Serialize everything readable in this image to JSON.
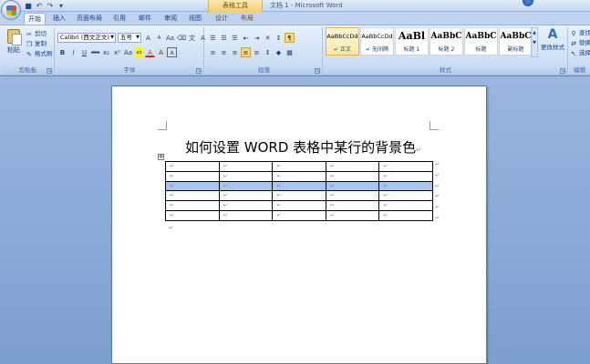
{
  "window": {
    "title": "文档 1 - Microsoft Word",
    "context_tools_label": "表格工具"
  },
  "quick_access": {
    "icons": [
      "save-icon",
      "undo-icon",
      "redo-icon",
      "customize-icon"
    ],
    "glyphs": [
      "■",
      "↶",
      "↷",
      "▾"
    ]
  },
  "tabs": [
    {
      "label": "开始",
      "active": true
    },
    {
      "label": "插入"
    },
    {
      "label": "页面布局"
    },
    {
      "label": "引用"
    },
    {
      "label": "邮件"
    },
    {
      "label": "审阅"
    },
    {
      "label": "视图"
    },
    {
      "label": "设计",
      "context": true
    },
    {
      "label": "布局",
      "context": true
    }
  ],
  "clipboard": {
    "paste": "粘贴",
    "cut": "剪切",
    "copy": "复制",
    "format_painter": "格式刷",
    "group_label": "剪贴板"
  },
  "font": {
    "font_name": "Calibri (西文正文)",
    "font_size": "五号",
    "group_label": "字体",
    "row1_buttons": [
      "A",
      "A",
      "Aa",
      "⌫",
      "文",
      "A"
    ],
    "row2_buttons": [
      "B",
      "I",
      "U",
      "abe",
      "x₂",
      "x²",
      "Aa",
      "ab",
      "A",
      "A",
      "A"
    ]
  },
  "paragraph": {
    "group_label": "段落",
    "row1_buttons": [
      "☰",
      "☰",
      "☰",
      "⇤",
      "⇥",
      "✕",
      "↕",
      "¶"
    ],
    "row2_buttons": [
      "≡",
      "≡",
      "≡",
      "≡",
      "≡",
      "↕",
      "◆",
      "▦"
    ]
  },
  "styles": {
    "group_label": "样式",
    "tiles": [
      {
        "sample": "AaBbCcDd",
        "name": "↵ 正文",
        "selected": true
      },
      {
        "sample": "AaBbCcDd",
        "name": "↵ 无间隔"
      },
      {
        "sample": "AaBl",
        "name": "标题 1"
      },
      {
        "sample": "AaBbC",
        "name": "标题 2"
      },
      {
        "sample": "AaBbC",
        "name": "标题"
      },
      {
        "sample": "AaBbC",
        "name": "副标题"
      }
    ],
    "change_styles": "更改样式"
  },
  "editing": {
    "group_label": "编辑",
    "find": "查找",
    "replace": "替换",
    "select": "选择"
  },
  "document": {
    "title": "如何设置 WORD 表格中某行的背景色",
    "paragraph_mark": "↵",
    "table_anchor": "✥",
    "table": {
      "rows": 6,
      "cols": 5,
      "shaded_row_index": 2,
      "shade_color": "#a7c6ea",
      "cell_mark": "↵"
    }
  }
}
